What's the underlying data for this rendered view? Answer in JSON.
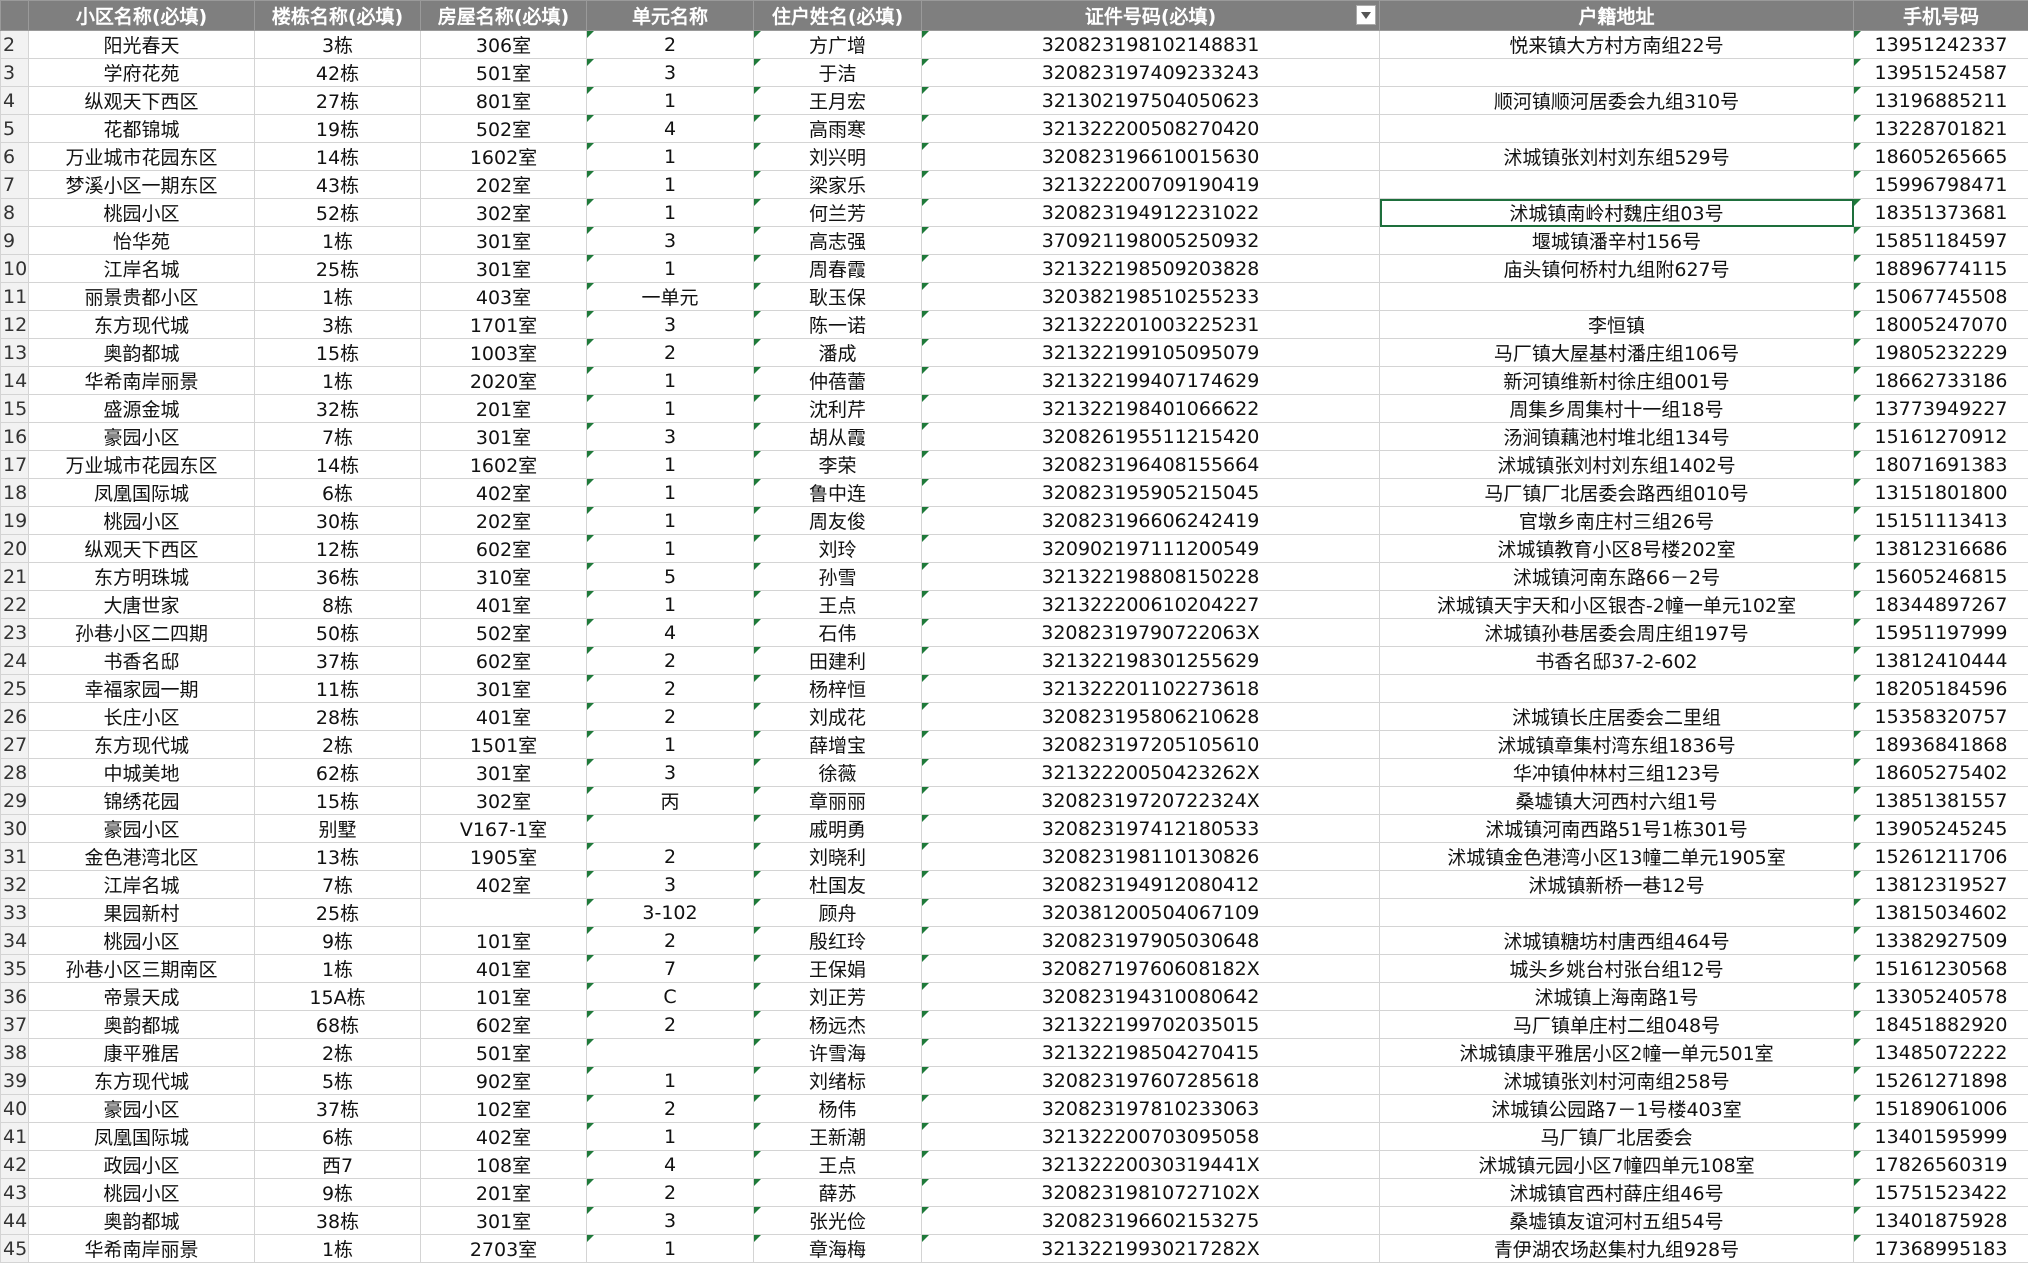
{
  "headers": [
    "小区名称(必填)",
    "楼栋名称(必填)",
    "房屋名称(必填)",
    "单元名称",
    "住户姓名(必填)",
    "证件号码(必填)",
    "户籍地址",
    "手机号码"
  ],
  "filter_column_index": 5,
  "rows": [
    {
      "n": "2",
      "c": [
        "阳光春天",
        "3栋",
        "306室",
        "2",
        "方广增",
        "320823198102148831",
        "悦来镇大方村方南组22号",
        "13951242337"
      ]
    },
    {
      "n": "3",
      "c": [
        "学府花苑",
        "42栋",
        "501室",
        "3",
        "于洁",
        "320823197409233243",
        "",
        "13951524587"
      ]
    },
    {
      "n": "4",
      "c": [
        "纵观天下西区",
        "27栋",
        "801室",
        "1",
        "王月宏",
        "321302197504050623",
        "顺河镇顺河居委会九组310号",
        "13196885211"
      ]
    },
    {
      "n": "5",
      "c": [
        "花都锦城",
        "19栋",
        "502室",
        "4",
        "高雨寒",
        "321322200508270420",
        "",
        "13228701821"
      ]
    },
    {
      "n": "6",
      "c": [
        "万业城市花园东区",
        "14栋",
        "1602室",
        "1",
        "刘兴明",
        "320823196610015630",
        "沭城镇张刘村刘东组529号",
        "18605265665"
      ]
    },
    {
      "n": "7",
      "c": [
        "梦溪小区一期东区",
        "43栋",
        "202室",
        "1",
        "梁家乐",
        "321322200709190419",
        "",
        "15996798471"
      ]
    },
    {
      "n": "8",
      "c": [
        "桃园小区",
        "52栋",
        "302室",
        "1",
        "何兰芳",
        "320823194912231022",
        "沭城镇南岭村魏庄组03号",
        "18351373681"
      ]
    },
    {
      "n": "9",
      "c": [
        "怡华苑",
        "1栋",
        "301室",
        "3",
        "高志强",
        "370921198005250932",
        "堰城镇潘辛村156号",
        "15851184597"
      ]
    },
    {
      "n": "10",
      "c": [
        "江岸名城",
        "25栋",
        "301室",
        "1",
        "周春霞",
        "321322198509203828",
        "庙头镇何桥村九组附627号",
        "18896774115"
      ]
    },
    {
      "n": "11",
      "c": [
        "丽景贵都小区",
        "1栋",
        "403室",
        "一单元",
        "耿玉保",
        "320382198510255233",
        "",
        "15067745508"
      ]
    },
    {
      "n": "12",
      "c": [
        "东方现代城",
        "3栋",
        "1701室",
        "3",
        "陈一诺",
        "321322201003225231",
        "李恒镇",
        "18005247070"
      ]
    },
    {
      "n": "13",
      "c": [
        "奥韵都城",
        "15栋",
        "1003室",
        "2",
        "潘成",
        "321322199105095079",
        "马厂镇大屋基村潘庄组106号",
        "19805232229"
      ]
    },
    {
      "n": "14",
      "c": [
        "华希南岸丽景",
        "1栋",
        "2020室",
        "1",
        "仲蓓蕾",
        "321322199407174629",
        "新河镇维新村徐庄组001号",
        "18662733186"
      ]
    },
    {
      "n": "15",
      "c": [
        "盛源金城",
        "32栋",
        "201室",
        "1",
        "沈利芹",
        "321322198401066622",
        "周集乡周集村十一组18号",
        "13773949227"
      ]
    },
    {
      "n": "16",
      "c": [
        "豪园小区",
        "7栋",
        "301室",
        "3",
        "胡从霞",
        "320826195511215420",
        "汤涧镇藕池村堆北组134号",
        "15161270912"
      ]
    },
    {
      "n": "17",
      "c": [
        "万业城市花园东区",
        "14栋",
        "1602室",
        "1",
        "李荣",
        "320823196408155664",
        "沭城镇张刘村刘东组1402号",
        "18071691383"
      ]
    },
    {
      "n": "18",
      "c": [
        "凤凰国际城",
        "6栋",
        "402室",
        "1",
        "鲁中连",
        "320823195905215045",
        "马厂镇厂北居委会路西组010号",
        "13151801800"
      ]
    },
    {
      "n": "19",
      "c": [
        "桃园小区",
        "30栋",
        "202室",
        "1",
        "周友俊",
        "320823196606242419",
        "官墩乡南庄村三组26号",
        "15151113413"
      ]
    },
    {
      "n": "20",
      "c": [
        "纵观天下西区",
        "12栋",
        "602室",
        "1",
        "刘玲",
        "320902197111200549",
        "沭城镇教育小区8号楼202室",
        "13812316686"
      ]
    },
    {
      "n": "21",
      "c": [
        "东方明珠城",
        "36栋",
        "310室",
        "5",
        "孙雪",
        "321322198808150228",
        "沭城镇河南东路66－2号",
        "15605246815"
      ]
    },
    {
      "n": "22",
      "c": [
        "大唐世家",
        "8栋",
        "401室",
        "1",
        "王点",
        "321322200610204227",
        "沭城镇天宇天和小区银杏-2幢一单元102室",
        "18344897267"
      ]
    },
    {
      "n": "23",
      "c": [
        "孙巷小区二四期",
        "50栋",
        "502室",
        "4",
        "石伟",
        "32082319790722063X",
        "沭城镇孙巷居委会周庄组197号",
        "15951197999"
      ]
    },
    {
      "n": "24",
      "c": [
        "书香名邸",
        "37栋",
        "602室",
        "2",
        "田建利",
        "321322198301255629",
        "书香名邸37-2-602",
        "13812410444"
      ]
    },
    {
      "n": "25",
      "c": [
        "幸福家园一期",
        "11栋",
        "301室",
        "2",
        "杨梓恒",
        "321322201102273618",
        "",
        "18205184596"
      ]
    },
    {
      "n": "26",
      "c": [
        "长庄小区",
        "28栋",
        "401室",
        "2",
        "刘成花",
        "320823195806210628",
        "沭城镇长庄居委会二里组",
        "15358320757"
      ]
    },
    {
      "n": "27",
      "c": [
        "东方现代城",
        "2栋",
        "1501室",
        "1",
        "薛增宝",
        "320823197205105610",
        "沭城镇章集村湾东组1836号",
        "18936841868"
      ]
    },
    {
      "n": "28",
      "c": [
        "中城美地",
        "62栋",
        "301室",
        "3",
        "徐薇",
        "32132220050423262X",
        "华冲镇仲林村三组123号",
        "18605275402"
      ]
    },
    {
      "n": "29",
      "c": [
        "锦绣花园",
        "15栋",
        "302室",
        "丙",
        "章丽丽",
        "32082319720722324X",
        "桑墟镇大河西村六组1号",
        "13851381557"
      ]
    },
    {
      "n": "30",
      "c": [
        "豪园小区",
        "别墅",
        "V167-1室",
        "",
        "戚明勇",
        "320823197412180533",
        "沭城镇河南西路51号1栋301号",
        "13905245245"
      ]
    },
    {
      "n": "31",
      "c": [
        "金色港湾北区",
        "13栋",
        "1905室",
        "2",
        "刘晓利",
        "320823198110130826",
        "沭城镇金色港湾小区13幢二单元1905室",
        "15261211706"
      ]
    },
    {
      "n": "32",
      "c": [
        "江岸名城",
        "7栋",
        "402室",
        "3",
        "杜国友",
        "320823194912080412",
        "沭城镇新桥一巷12号",
        "13812319527"
      ]
    },
    {
      "n": "33",
      "c": [
        "果园新村",
        "25栋",
        "",
        "3-102",
        "顾舟",
        "320381200504067109",
        "",
        "13815034602"
      ]
    },
    {
      "n": "34",
      "c": [
        "桃园小区",
        "9栋",
        "101室",
        "2",
        "殷红玲",
        "320823197905030648",
        "沭城镇糖坊村唐西组464号",
        "13382927509"
      ]
    },
    {
      "n": "35",
      "c": [
        "孙巷小区三期南区",
        "1栋",
        "401室",
        "7",
        "王保娟",
        "32082719760608182X",
        "城头乡姚台村张台组12号",
        "15161230568"
      ]
    },
    {
      "n": "36",
      "c": [
        "帝景天成",
        "15A栋",
        "101室",
        "C",
        "刘正芳",
        "320823194310080642",
        "沭城镇上海南路1号",
        "13305240578"
      ]
    },
    {
      "n": "37",
      "c": [
        "奥韵都城",
        "68栋",
        "602室",
        "2",
        "杨远杰",
        "321322199702035015",
        "马厂镇单庄村二组048号",
        "18451882920"
      ]
    },
    {
      "n": "38",
      "c": [
        "康平雅居",
        "2栋",
        "501室",
        "",
        "许雪海",
        "321322198504270415",
        "沭城镇康平雅居小区2幢一单元501室",
        "13485072222"
      ]
    },
    {
      "n": "39",
      "c": [
        "东方现代城",
        "5栋",
        "902室",
        "1",
        "刘绪标",
        "320823197607285618",
        "沭城镇张刘村河南组258号",
        "15261271898"
      ]
    },
    {
      "n": "40",
      "c": [
        "豪园小区",
        "37栋",
        "102室",
        "2",
        "杨伟",
        "320823197810233063",
        "沭城镇公园路7－1号楼403室",
        "15189061006"
      ]
    },
    {
      "n": "41",
      "c": [
        "凤凰国际城",
        "6栋",
        "402室",
        "1",
        "王新潮",
        "321322200703095058",
        "马厂镇厂北居委会",
        "13401595999"
      ]
    },
    {
      "n": "42",
      "c": [
        "政园小区",
        "西7",
        "108室",
        "4",
        "王点",
        "32132220030319441X",
        "沭城镇元园小区7幢四单元108室",
        "17826560319"
      ]
    },
    {
      "n": "43",
      "c": [
        "桃园小区",
        "9栋",
        "201室",
        "2",
        "薛苏",
        "32082319810727102X",
        "沭城镇官西村薛庄组46号",
        "15751523422"
      ]
    },
    {
      "n": "44",
      "c": [
        "奥韵都城",
        "38栋",
        "301室",
        "3",
        "张光俭",
        "320823196602153275",
        "桑墟镇友谊河村五组54号",
        "13401875928"
      ]
    },
    {
      "n": "45",
      "c": [
        "华希南岸丽景",
        "1栋",
        "2703室",
        "1",
        "章海梅",
        "32132219930217282X",
        "青伊湖农场赵集村九组928号",
        "17368995183"
      ]
    }
  ]
}
